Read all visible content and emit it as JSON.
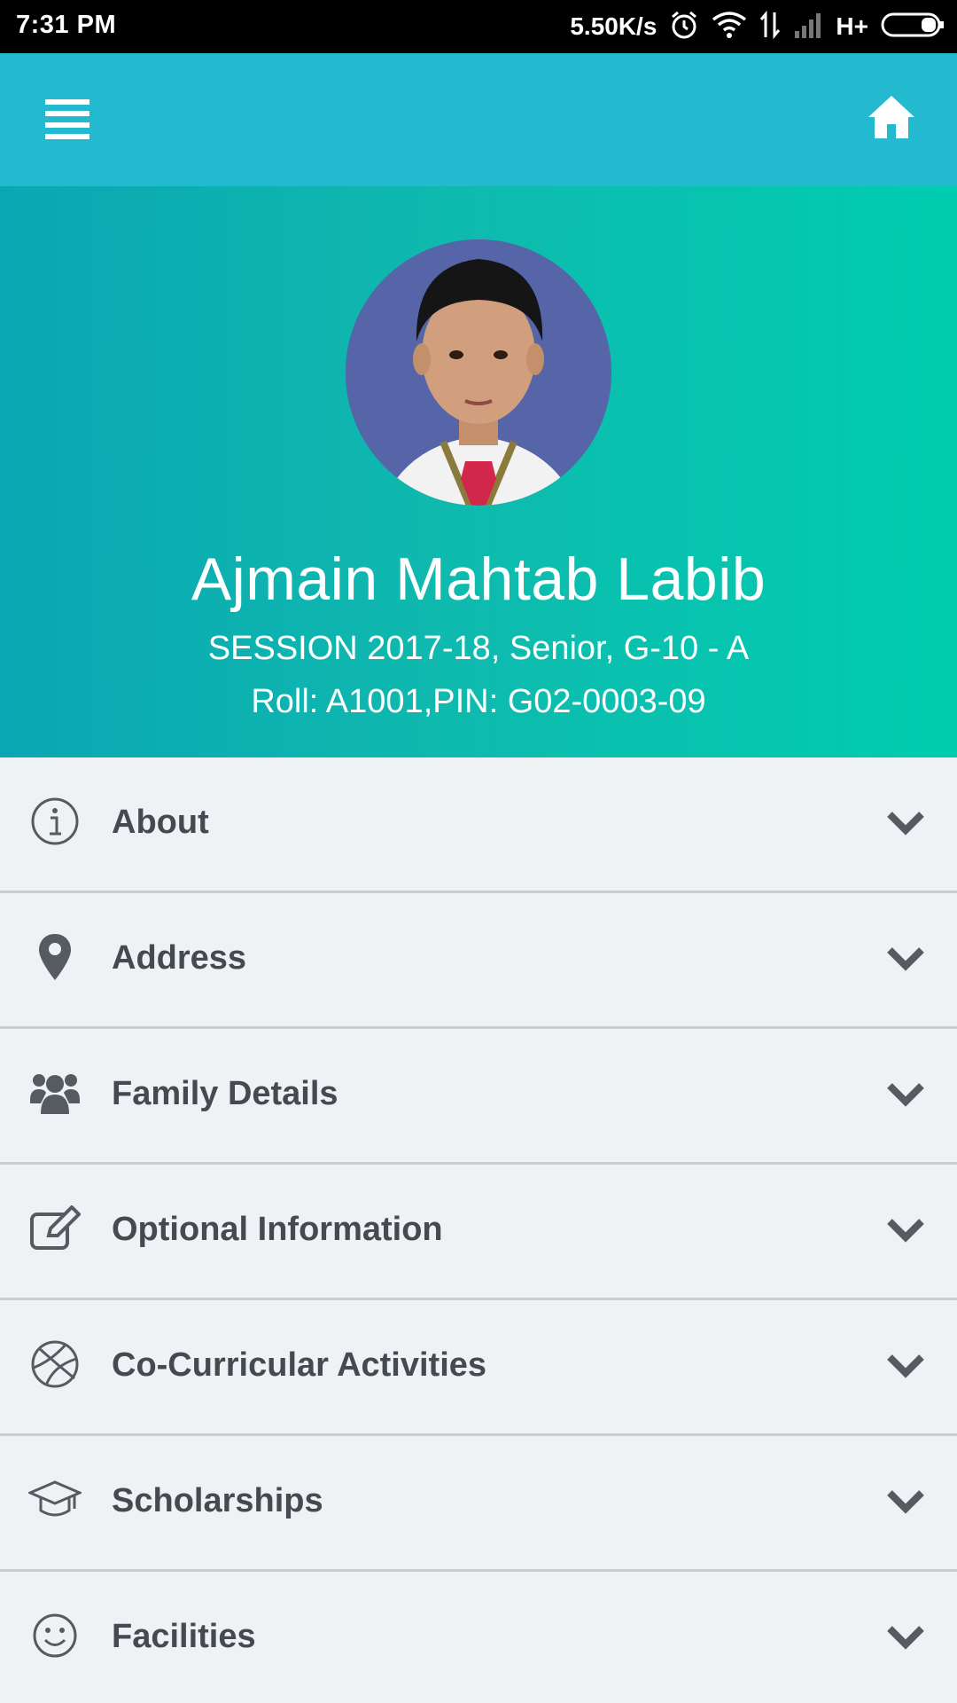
{
  "status_bar": {
    "time": "7:31 PM",
    "net_speed": "5.50K/s",
    "network_type": "H+",
    "icons": [
      "alarm-icon",
      "wifi-icon",
      "data-transfer-icon",
      "signal-icon",
      "battery-icon"
    ]
  },
  "app_bar": {
    "menu_icon": "menu-icon",
    "home_icon": "home-icon",
    "color": "#23b9cf"
  },
  "profile": {
    "name": "Ajmain Mahtab Labib",
    "session": "SESSION 2017-18, Senior, G-10 - A",
    "roll_pin": "Roll: A1001,PIN: G02-0003-09",
    "gradient": [
      "#09a7b3",
      "#00cdb0"
    ]
  },
  "sections": [
    {
      "label": "About",
      "icon": "info-icon"
    },
    {
      "label": "Address",
      "icon": "map-pin-icon"
    },
    {
      "label": "Family Details",
      "icon": "users-icon"
    },
    {
      "label": "Optional Information",
      "icon": "edit-icon"
    },
    {
      "label": "Co-Curricular Activities",
      "icon": "basketball-icon"
    },
    {
      "label": "Scholarships",
      "icon": "graduation-cap-icon"
    },
    {
      "label": "Facilities",
      "icon": "smile-icon"
    }
  ]
}
